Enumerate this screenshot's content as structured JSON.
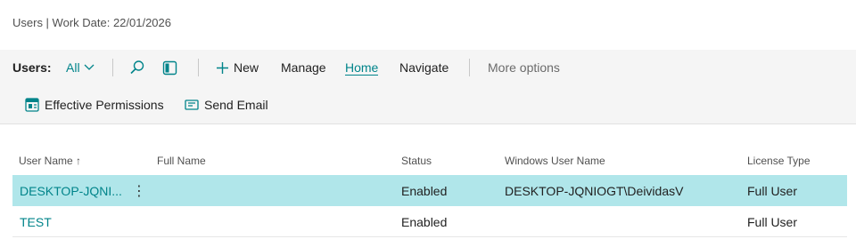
{
  "breadcrumb": "Users | Work Date: 22/01/2026",
  "actionbar": {
    "title": "Users:",
    "filter": "All",
    "new_label": "New",
    "manage_label": "Manage",
    "home_label": "Home",
    "navigate_label": "Navigate",
    "more_label": "More options"
  },
  "subbar": {
    "permissions_label": "Effective Permissions",
    "email_label": "Send Email"
  },
  "table": {
    "headers": {
      "user_name": "User Name",
      "sort": "↑",
      "full_name": "Full Name",
      "status": "Status",
      "windows_user": "Windows User Name",
      "license": "License Type"
    },
    "rows": [
      {
        "user_name": "DESKTOP-JQNI...",
        "full_name": "",
        "status": "Enabled",
        "windows_user": "DESKTOP-JQNIOGT\\DeividasV",
        "license": "Full User"
      },
      {
        "user_name": "TEST",
        "full_name": "",
        "status": "Enabled",
        "windows_user": "",
        "license": "Full User"
      }
    ]
  },
  "colors": {
    "accent": "#00848a",
    "selected_row": "#b0e6ea",
    "bar_bg": "#f5f5f5"
  },
  "icons": [
    "chevron-down-icon",
    "search-icon",
    "filter-pane-icon",
    "plus-icon",
    "permissions-icon",
    "email-icon",
    "row-menu-icon"
  ]
}
